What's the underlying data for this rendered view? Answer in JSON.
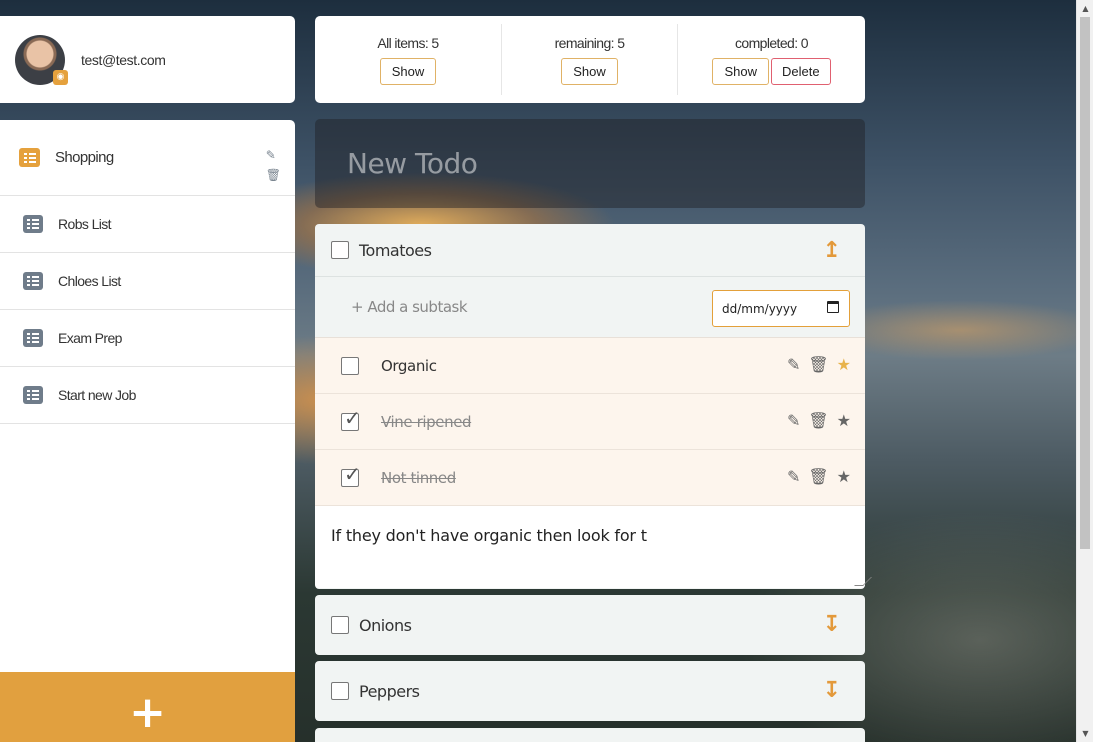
{
  "user": {
    "email": "test@test.com"
  },
  "lists": [
    {
      "label": "Shopping",
      "active": true
    },
    {
      "label": "Robs List"
    },
    {
      "label": "Chloes List"
    },
    {
      "label": "Exam Prep"
    },
    {
      "label": "Start new Job"
    }
  ],
  "add_list_label": "+",
  "stats": {
    "all_label": "All items: 5",
    "remaining_label": "remaining: 5",
    "completed_label": "completed: 0",
    "show_label": "Show",
    "delete_label": "Delete"
  },
  "new_todo_placeholder": "New Todo",
  "todos": [
    {
      "title": "Tomatoes",
      "expanded": true,
      "subtask_placeholder": "+ Add a subtask",
      "date_placeholder": "dd/mm/yyyy",
      "subtasks": [
        {
          "label": "Organic",
          "done": false,
          "starred": true
        },
        {
          "label": "Vine ripened",
          "done": true,
          "starred": false
        },
        {
          "label": "Not tinned",
          "done": true,
          "starred": false
        }
      ],
      "notes": "If they don't have organic then look for t"
    },
    {
      "title": "Onions",
      "expanded": false
    },
    {
      "title": "Peppers",
      "expanded": false
    }
  ],
  "icons": {
    "edit": "edit-icon",
    "trash": "trash-icon",
    "star": "star-icon",
    "arrow_up": "move-up-arrow-icon",
    "arrow_down": "move-down-arrow-icon",
    "list": "list-icon",
    "camera": "camera-icon",
    "calendar": "calendar-icon"
  },
  "colors": {
    "accent": "#e1a03f",
    "delete": "#e06070",
    "star_active": "#e8b34b"
  }
}
